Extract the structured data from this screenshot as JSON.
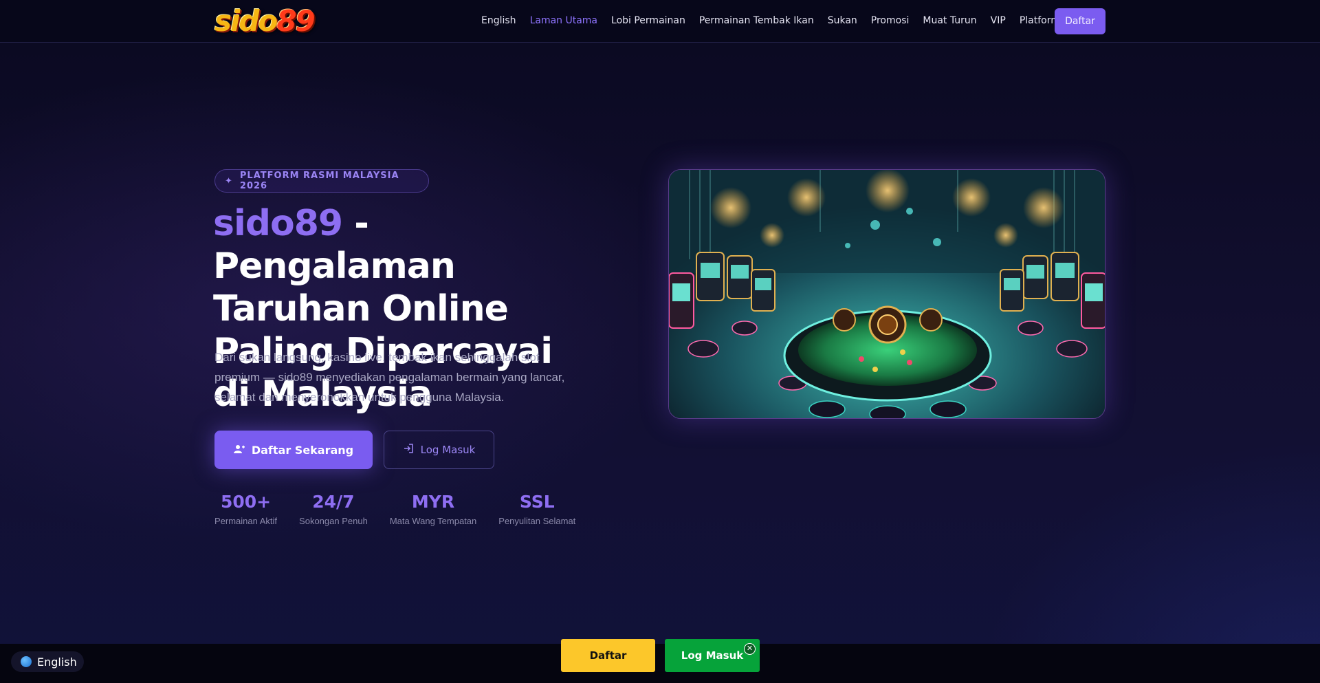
{
  "header": {
    "nav": [
      {
        "label": "English",
        "active": false
      },
      {
        "label": "Laman Utama",
        "active": true
      },
      {
        "label": "Lobi Permainan",
        "active": false
      },
      {
        "label": "Permainan Tembak Ikan",
        "active": false
      },
      {
        "label": "Sukan",
        "active": false
      },
      {
        "label": "Promosi",
        "active": false
      },
      {
        "label": "Muat Turun",
        "active": false
      },
      {
        "label": "VIP",
        "active": false
      },
      {
        "label": "Platform",
        "active": false
      }
    ],
    "register_label": "Daftar"
  },
  "hero": {
    "badge": "PLATFORM RASMI MALAYSIA 2026",
    "title_brand": "sido89",
    "title_rest": " - Pengalaman Taruhan Online Paling Dipercayai di Malaysia",
    "description": "Dari sukan langsung, kasino live, tembak ikan sehinggalah slot premium — sido89 menyediakan pengalaman bermain yang lancar, selamat dan menyeronokkan untuk pengguna Malaysia.",
    "primary_cta": "Daftar Sekarang",
    "secondary_cta": "Log Masuk",
    "stats": [
      {
        "value": "500+",
        "label": "Permainan Aktif"
      },
      {
        "value": "24/7",
        "label": "Sokongan Penuh"
      },
      {
        "value": "MYR",
        "label": "Mata Wang Tempatan"
      },
      {
        "value": "SSL",
        "label": "Penyulitan Selamat"
      }
    ]
  },
  "language_switcher": {
    "label": "English",
    "icon": "globe-icon"
  },
  "bottom_bar": {
    "register_label": "Daftar",
    "login_label": "Log Masuk",
    "close_icon": "close-icon"
  },
  "colors": {
    "accent": "#7b5cf0",
    "brand_text": "#8e6ef2",
    "register_yellow": "#fcc72a",
    "login_green": "#06a33a",
    "background": "#0d0b24"
  }
}
